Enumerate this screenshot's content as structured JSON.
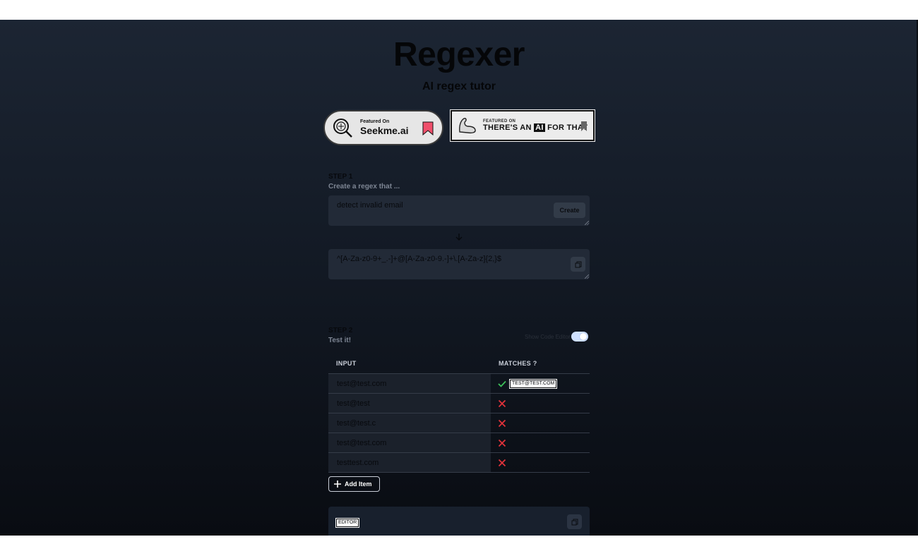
{
  "header": {
    "title": "Regexer",
    "subtitle": "AI regex tutor"
  },
  "badges": [
    {
      "small": "Featured On",
      "big": "Seekme.ai",
      "accent": "#ef4f6b"
    },
    {
      "small": "FEATURED ON",
      "big_pre": "THERE'S AN ",
      "big_ai": "AI",
      "big_post": " FOR THAT"
    }
  ],
  "step1": {
    "label": "STEP 1",
    "desc": "Create a regex that ...",
    "prompt_value": "detect invalid email",
    "create_label": "Create",
    "regex_value": "^[A-Za-z0-9+_.-]+@[A-Za-z0-9.-]+\\.[A-Za-z]{2,}$"
  },
  "step2": {
    "label": "STEP 2",
    "desc": "Test it!",
    "toggle_label": "Show Code Editor",
    "toggle_on": true,
    "columns": [
      "INPUT",
      "MATCHES ?"
    ],
    "rows": [
      {
        "input": "test@test.com",
        "match": true,
        "tag": "TEST@TEST.COM"
      },
      {
        "input": "test@test",
        "match": false
      },
      {
        "input": "test@test.c",
        "match": false
      },
      {
        "input": "test@test.com",
        "match": false
      },
      {
        "input": "testtest.com",
        "match": false
      }
    ],
    "add_label": "Add Item"
  },
  "editor": {
    "label": "EDITOR"
  },
  "colors": {
    "match": "#3cc25a",
    "nomatch": "#e0323a",
    "toggle": "#cfe0ff"
  }
}
